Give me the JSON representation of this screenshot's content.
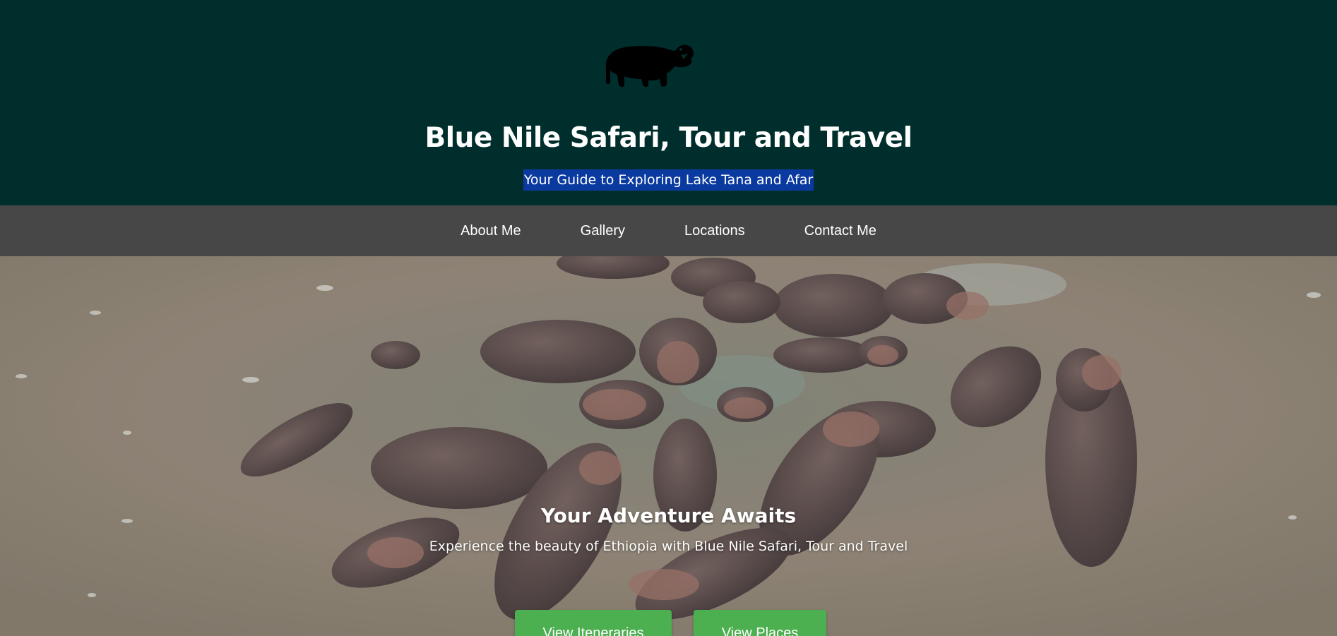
{
  "header": {
    "logo_icon": "hippo-silhouette-icon",
    "title": "Blue Nile Safari, Tour and Travel",
    "tagline": "Your Guide to Exploring Lake Tana and Afar",
    "background_color": "#002e2d",
    "tagline_highlight_color": "#0a3aa0"
  },
  "nav": {
    "items": [
      {
        "label": "About Me"
      },
      {
        "label": "Gallery"
      },
      {
        "label": "Locations"
      },
      {
        "label": "Contact Me"
      }
    ],
    "background_color": "#474747"
  },
  "hero": {
    "background_image": "aerial photo of hippos in brown river water",
    "title": "Your Adventure Awaits",
    "subtitle": "Experience the beauty of Ethiopia with Blue Nile Safari, Tour and Travel",
    "buttons": [
      {
        "label": "View Iteneraries"
      },
      {
        "label": "View Places"
      }
    ],
    "button_color": "#4caf50"
  }
}
